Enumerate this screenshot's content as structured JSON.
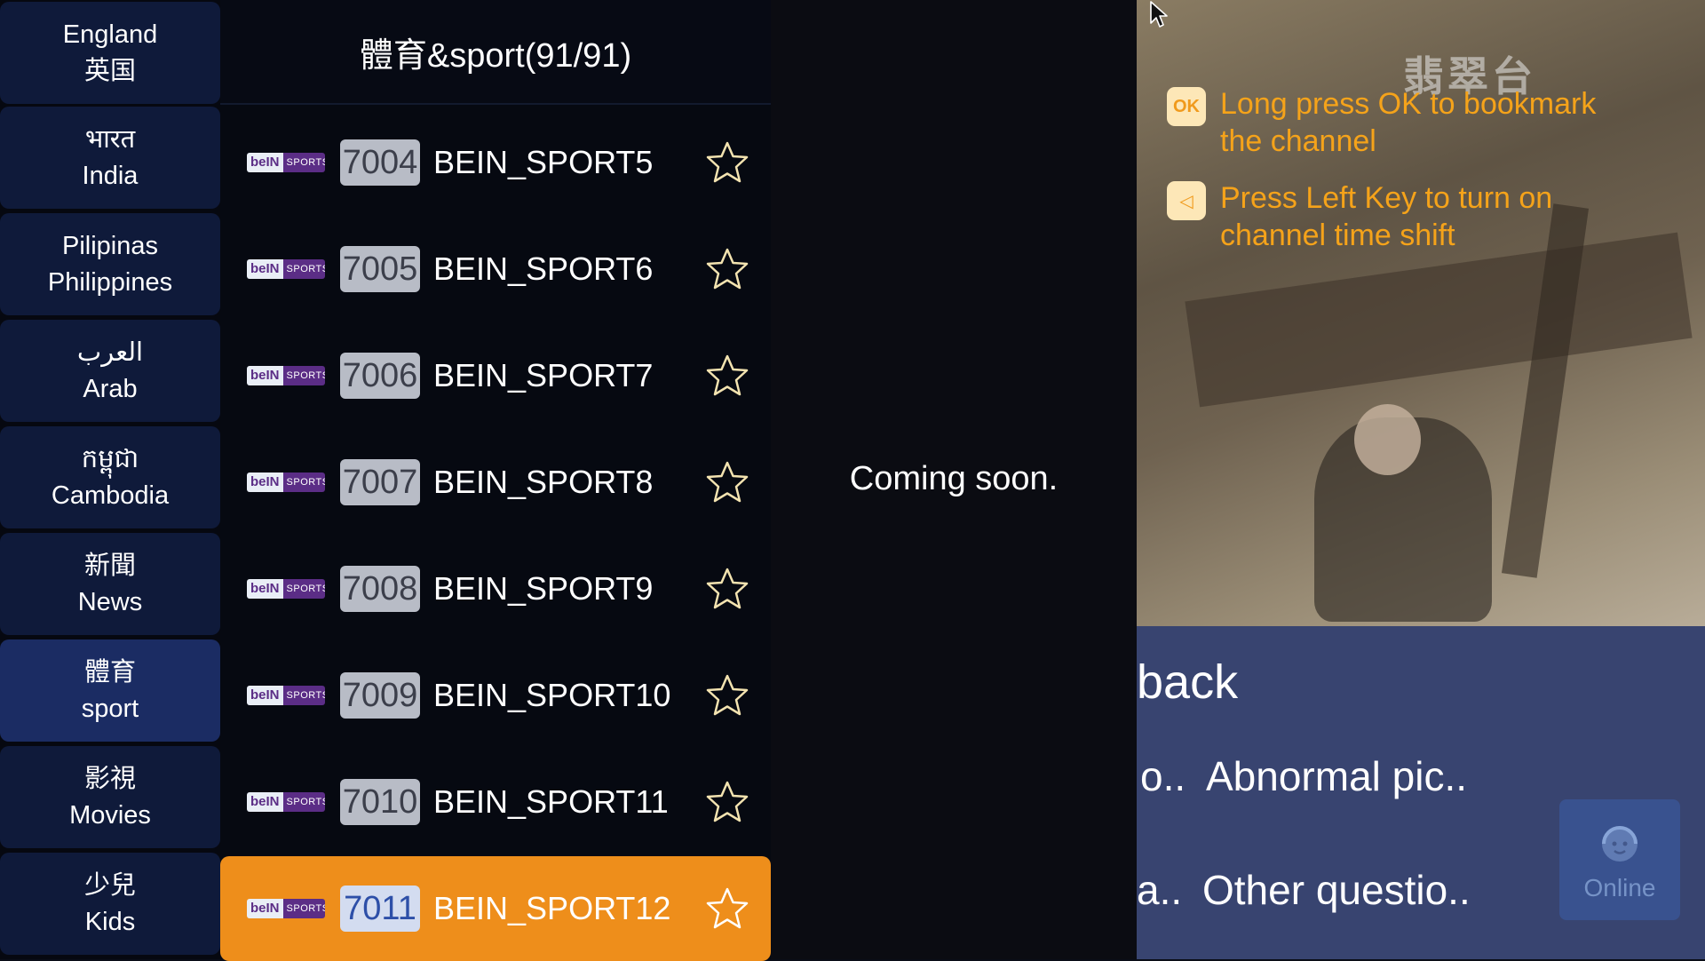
{
  "categories": [
    {
      "line1": "England",
      "line2": "英国",
      "active": false
    },
    {
      "line1": "भारत",
      "line2": "India",
      "active": false
    },
    {
      "line1": "Pilipinas",
      "line2": "Philippines",
      "active": false
    },
    {
      "line1": "العرب",
      "line2": "Arab",
      "active": false
    },
    {
      "line1": "កម្ពុជា",
      "line2": "Cambodia",
      "active": false
    },
    {
      "line1": "新聞",
      "line2": "News",
      "active": false
    },
    {
      "line1": "體育",
      "line2": "sport",
      "active": true
    },
    {
      "line1": "影視",
      "line2": "Movies",
      "active": false
    },
    {
      "line1": "少兒",
      "line2": "Kids",
      "active": false
    }
  ],
  "channel_list": {
    "header": "體育&sport(91/91)",
    "logo_text_1": "beIN",
    "logo_text_2": "SPORTS",
    "channels": [
      {
        "number": "7004",
        "name": "BEIN_SPORT5",
        "selected": false
      },
      {
        "number": "7005",
        "name": "BEIN_SPORT6",
        "selected": false
      },
      {
        "number": "7006",
        "name": "BEIN_SPORT7",
        "selected": false
      },
      {
        "number": "7007",
        "name": "BEIN_SPORT8",
        "selected": false
      },
      {
        "number": "7008",
        "name": "BEIN_SPORT9",
        "selected": false
      },
      {
        "number": "7009",
        "name": "BEIN_SPORT10",
        "selected": false
      },
      {
        "number": "7010",
        "name": "BEIN_SPORT11",
        "selected": false
      },
      {
        "number": "7011",
        "name": "BEIN_SPORT12",
        "selected": true
      }
    ]
  },
  "info": {
    "coming_soon": "Coming soon."
  },
  "video": {
    "watermark": "翡翠台",
    "hints": [
      {
        "icon": "OK",
        "text": "Long press OK to bookmark the channel"
      },
      {
        "icon": "◁",
        "text": "Press Left Key to turn on channel time shift"
      }
    ]
  },
  "feedback": {
    "title": "back",
    "items": [
      {
        "prefix": "o..",
        "label": "Abnormal pic.."
      },
      {
        "prefix": "a..",
        "label": "Other questio.."
      }
    ],
    "online_label": "Online"
  },
  "colors": {
    "accent": "#ee8e1b",
    "hint_text": "#f5a31a",
    "category_bg": "#0f1a3a",
    "category_active_bg": "#1b2c63",
    "feedback_bg": "#384470"
  },
  "icons": [
    "star-outline-icon",
    "ok-key-icon",
    "left-key-icon",
    "headset-icon",
    "mouse-cursor-icon",
    "bein-sports-logo"
  ]
}
